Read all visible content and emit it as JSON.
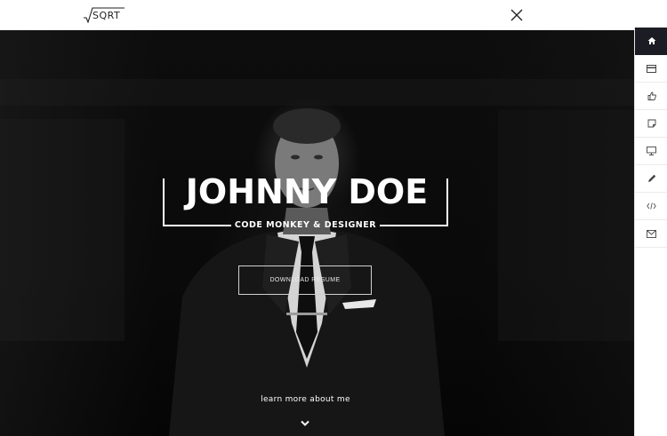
{
  "header": {
    "logo_text": "SQRT"
  },
  "hero": {
    "title": "JOHNNY DOE",
    "subtitle": "CODE MONKEY & DESIGNER",
    "download_button": "DOWNLOAD RESUME",
    "learn_more": "learn more about me"
  },
  "sidebar": {
    "items": [
      {
        "icon": "home-icon",
        "active": true
      },
      {
        "icon": "credit-card-icon",
        "active": false
      },
      {
        "icon": "thumbs-up-icon",
        "active": false
      },
      {
        "icon": "note-icon",
        "active": false
      },
      {
        "icon": "monitor-icon",
        "active": false
      },
      {
        "icon": "pencil-icon",
        "active": false
      },
      {
        "icon": "code-icon",
        "active": false
      },
      {
        "icon": "envelope-icon",
        "active": false
      }
    ]
  },
  "colors": {
    "sidebar_active": "#1c1d24",
    "hero_bg": "#0b0b0b",
    "text_light": "#ffffff"
  }
}
